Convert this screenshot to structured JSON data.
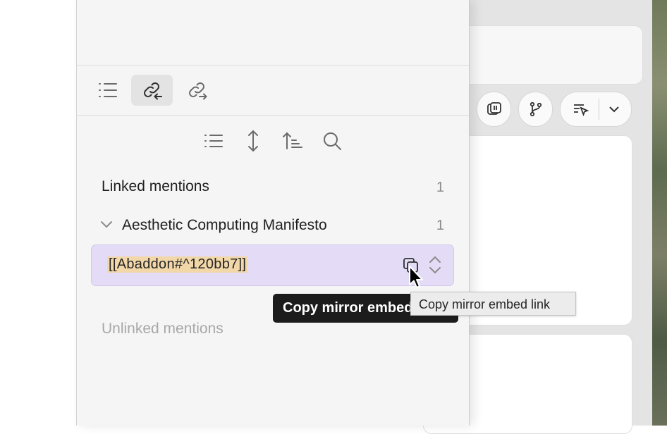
{
  "panel": {
    "tabs": [
      {
        "name": "outline",
        "icon": "list-icon",
        "active": false
      },
      {
        "name": "backlinks",
        "icon": "link-incoming-icon",
        "active": true
      },
      {
        "name": "outgoing-links",
        "icon": "link-outgoing-icon",
        "active": false
      }
    ],
    "controls": [
      "list-icon",
      "expand-vertical-icon",
      "sort-icon",
      "search-icon"
    ],
    "linked": {
      "title": "Linked mentions",
      "count": "1",
      "groups": [
        {
          "title": "Aesthetic Computing Manifesto",
          "count": "1",
          "expanded": true,
          "mentions": [
            {
              "text": "[[Abaddon#^120bb7]]",
              "hover_actions": [
                "copy-icon",
                "up-down-chevron-icon"
              ]
            }
          ]
        }
      ]
    },
    "unlinked": {
      "title": "Unlinked mentions"
    }
  },
  "tooltips": {
    "plugin": "Copy mirror embed link",
    "native": "Copy mirror embed link"
  },
  "editor": {
    "toolbar": [
      "layout-icon",
      "git-branch-icon",
      "filter-cursor-icon",
      "chevron-down-icon"
    ]
  },
  "colors": {
    "highlight_row": "#e4dcf6",
    "text_highlight": "#f2d7a8",
    "tooltip_dark": "#1c1c1c"
  }
}
